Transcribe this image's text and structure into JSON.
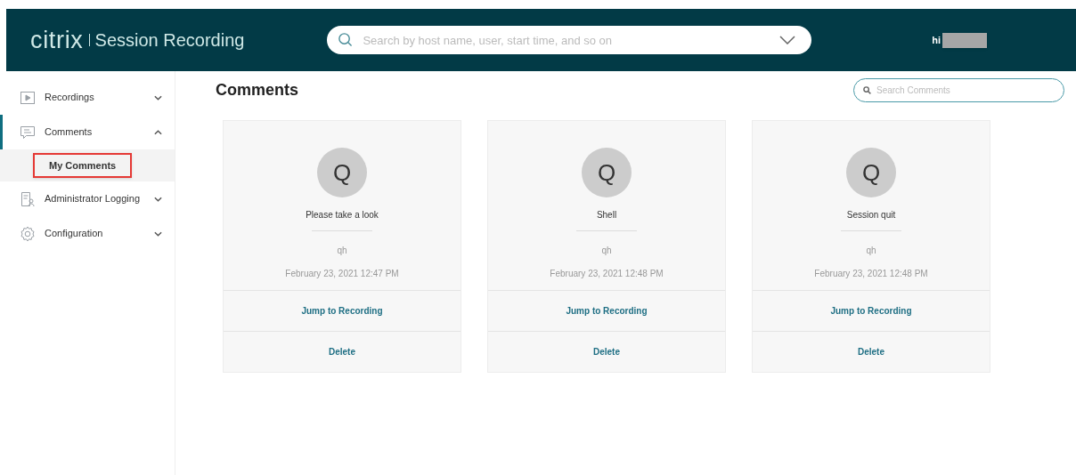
{
  "header": {
    "logo": "citrix",
    "product": "Session Recording",
    "search": {
      "placeholder": "Search by host name, user, start time, and so on"
    },
    "greeting": "hi"
  },
  "sidebar": {
    "items": [
      {
        "kind": "play",
        "label": "Recordings",
        "expanded": false,
        "selected": false
      },
      {
        "kind": "comment",
        "label": "Comments",
        "expanded": true,
        "selected": true,
        "children": [
          {
            "label": "My Comments",
            "selected": true,
            "highlighted": true
          }
        ]
      },
      {
        "kind": "log",
        "label": "Administrator Logging",
        "expanded": false,
        "selected": false
      },
      {
        "kind": "gear",
        "label": "Configuration",
        "expanded": false,
        "selected": false
      }
    ]
  },
  "page": {
    "title": "Comments",
    "search": {
      "placeholder": "Search Comments"
    }
  },
  "comments": [
    {
      "avatar": "Q",
      "text": "Please take a look",
      "user": "qh",
      "date": "February 23, 2021 12:47 PM",
      "actions": [
        "Jump to Recording",
        "Delete"
      ]
    },
    {
      "avatar": "Q",
      "text": "Shell",
      "user": "qh",
      "date": "February 23, 2021 12:48 PM",
      "actions": [
        "Jump to Recording",
        "Delete"
      ]
    },
    {
      "avatar": "Q",
      "text": "Session quit",
      "user": "qh",
      "date": "February 23, 2021 12:48 PM",
      "actions": [
        "Jump to Recording",
        "Delete"
      ]
    }
  ]
}
